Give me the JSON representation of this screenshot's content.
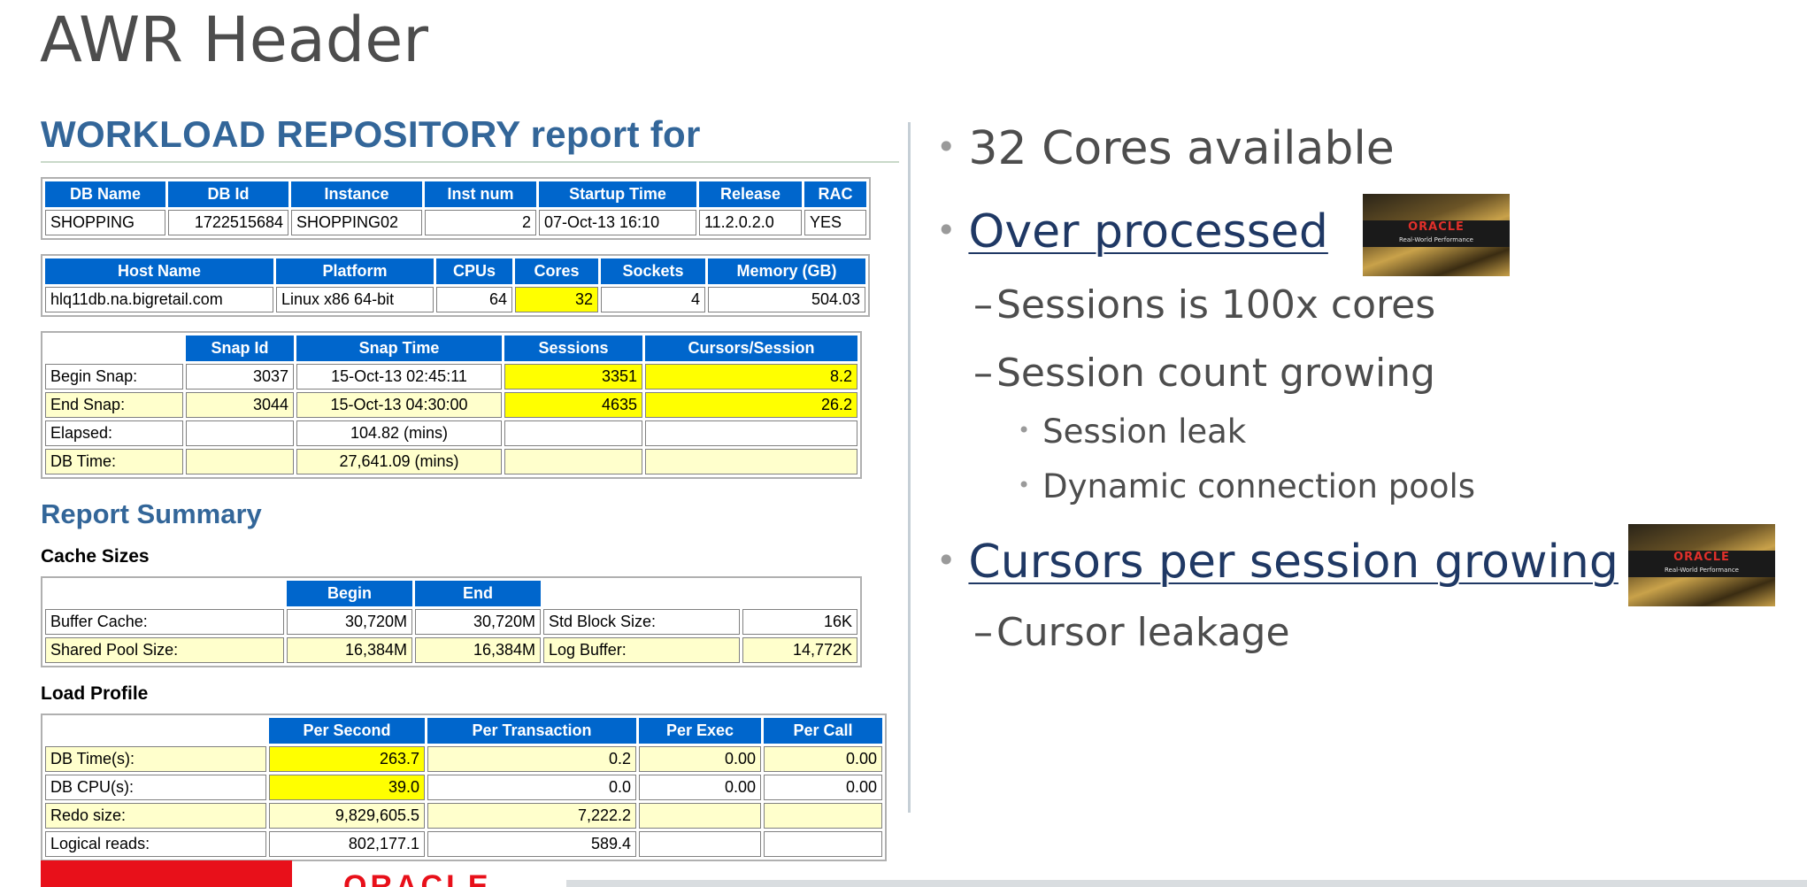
{
  "slide": {
    "title": "AWR Header"
  },
  "report": {
    "heading": "WORKLOAD REPOSITORY report for",
    "db_table": {
      "headers": [
        "DB Name",
        "DB Id",
        "Instance",
        "Inst num",
        "Startup Time",
        "Release",
        "RAC"
      ],
      "row": [
        "SHOPPING",
        "1722515684",
        "SHOPPING02",
        "2",
        "07-Oct-13 16:10",
        "11.2.0.2.0",
        "YES"
      ]
    },
    "host_table": {
      "headers": [
        "Host Name",
        "Platform",
        "CPUs",
        "Cores",
        "Sockets",
        "Memory (GB)"
      ],
      "row": [
        "hlq11db.na.bigretail.com",
        "Linux x86 64-bit",
        "64",
        "32",
        "4",
        "504.03"
      ]
    },
    "snap_table": {
      "headers": [
        "",
        "Snap Id",
        "Snap Time",
        "Sessions",
        "Cursors/Session"
      ],
      "rows": [
        [
          "Begin Snap:",
          "3037",
          "15-Oct-13 02:45:11",
          "3351",
          "8.2"
        ],
        [
          "End Snap:",
          "3044",
          "15-Oct-13 04:30:00",
          "4635",
          "26.2"
        ],
        [
          "Elapsed:",
          "",
          "104.82 (mins)",
          "",
          ""
        ],
        [
          "DB Time:",
          "",
          "27,641.09 (mins)",
          "",
          ""
        ]
      ]
    },
    "summary_heading": "Report Summary",
    "cache_heading": "Cache Sizes",
    "cache_table": {
      "headers": [
        "",
        "Begin",
        "End"
      ],
      "rows": [
        [
          "Buffer Cache:",
          "30,720M",
          "30,720M",
          "Std Block Size:",
          "16K"
        ],
        [
          "Shared Pool Size:",
          "16,384M",
          "16,384M",
          "Log Buffer:",
          "14,772K"
        ]
      ]
    },
    "load_heading": "Load Profile",
    "load_table": {
      "headers": [
        "",
        "Per Second",
        "Per Transaction",
        "Per Exec",
        "Per Call"
      ],
      "rows": [
        [
          "DB Time(s):",
          "263.7",
          "0.2",
          "0.00",
          "0.00"
        ],
        [
          "DB CPU(s):",
          "39.0",
          "0.0",
          "0.00",
          "0.00"
        ],
        [
          "Redo size:",
          "9,829,605.5",
          "7,222.2",
          "",
          ""
        ],
        [
          "Logical reads:",
          "802,177.1",
          "589.4",
          "",
          ""
        ]
      ]
    }
  },
  "bullets": {
    "cores": "32 Cores available",
    "over_processed": "Over processed",
    "sessions_100x": "Sessions is 100x cores",
    "session_count": "Session count growing",
    "session_leak": "Session leak",
    "dynamic_pools": "Dynamic connection pools",
    "cursors_growing": "Cursors per session growing",
    "cursor_leakage": "Cursor leakage"
  },
  "badge": {
    "logo_text": "ORACLE",
    "tagline": "Real-World Performance"
  },
  "footer": {
    "logo_text": "ORACLE"
  },
  "colors": {
    "header_blue": "#0066cc",
    "heading_blue": "#336699",
    "highlight_yellow": "#ffff00",
    "alt_row": "#ffffcc",
    "oracle_red": "#e8101a",
    "link_navy": "#1f3864"
  }
}
